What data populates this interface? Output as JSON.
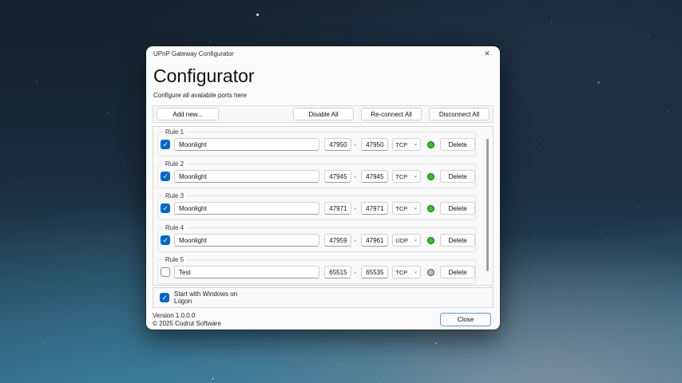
{
  "window": {
    "title": "UPnP Gateway Configurator",
    "heading": "Configurator",
    "subtitle": "Configure all avalabile ports here"
  },
  "icons": {
    "close": "✕",
    "chevron_down": "⌄"
  },
  "ui": {
    "port_separator": "-"
  },
  "toolbar": {
    "add_new": "Add new...",
    "disable_all": "Disable All",
    "reconnect_all": "Re-connect All",
    "disconnect_all": "Disconnect All"
  },
  "rules": [
    {
      "label": "Rule 1",
      "enabled": true,
      "name": "Moonlight",
      "port_from": "47950",
      "port_to": "47950",
      "protocol": "TCP",
      "status": "connected",
      "delete_label": "Delete"
    },
    {
      "label": "Rule 2",
      "enabled": true,
      "name": "Moonlight",
      "port_from": "47945",
      "port_to": "47945",
      "protocol": "TCP",
      "status": "connected",
      "delete_label": "Delete"
    },
    {
      "label": "Rule 3",
      "enabled": true,
      "name": "Moonlight",
      "port_from": "47971",
      "port_to": "47971",
      "protocol": "TCP",
      "status": "connected",
      "delete_label": "Delete"
    },
    {
      "label": "Rule 4",
      "enabled": true,
      "name": "Moonlight",
      "port_from": "47959",
      "port_to": "47961",
      "protocol": "UDP",
      "status": "connected",
      "delete_label": "Delete"
    },
    {
      "label": "Rule 5",
      "enabled": false,
      "name": "Test",
      "port_from": "65515",
      "port_to": "65535",
      "protocol": "TCP",
      "status": "disconnected",
      "delete_label": "Delete"
    }
  ],
  "startup": {
    "label": "Start with Windows on Logon",
    "enabled": true
  },
  "footer": {
    "version": "Version 1.0.0.0",
    "copyright": "© 2025 Codrut Software",
    "close_button": "Close"
  },
  "colors": {
    "checkbox_accent": "#0067c0",
    "status_connected": "#2fc32f",
    "status_disconnected": "#bdbdbd",
    "close_button_border": "#5b9bd5"
  }
}
